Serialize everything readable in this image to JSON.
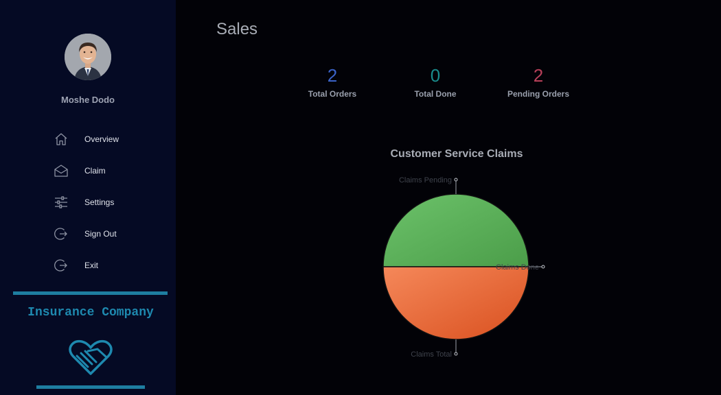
{
  "sidebar": {
    "username": "Moshe Dodo",
    "items": [
      {
        "label": "Overview",
        "icon": "home-icon"
      },
      {
        "label": "Claim",
        "icon": "envelope-open-icon"
      },
      {
        "label": "Settings",
        "icon": "sliders-icon"
      },
      {
        "label": "Sign Out",
        "icon": "sign-out-icon"
      },
      {
        "label": "Exit",
        "icon": "exit-icon"
      }
    ],
    "company_name": "Insurance Company",
    "accent_color": "#1e7ea1"
  },
  "main": {
    "title": "Sales",
    "stats": [
      {
        "value": "2",
        "label": "Total Orders",
        "color": "#3b63c8"
      },
      {
        "value": "0",
        "label": "Total Done",
        "color": "#1a8c8c"
      },
      {
        "value": "2",
        "label": "Pending Orders",
        "color": "#b8405a"
      }
    ]
  },
  "chart_data": {
    "type": "pie",
    "title": "Customer Service Claims",
    "slices": [
      {
        "label": "Claims Pending",
        "value": 2,
        "color": "#5cae5a"
      },
      {
        "label": "Claims Done",
        "value": 0,
        "color": "#8a8f99"
      },
      {
        "label": "Claims Total",
        "value": 2,
        "color": "#e8683a"
      }
    ]
  }
}
